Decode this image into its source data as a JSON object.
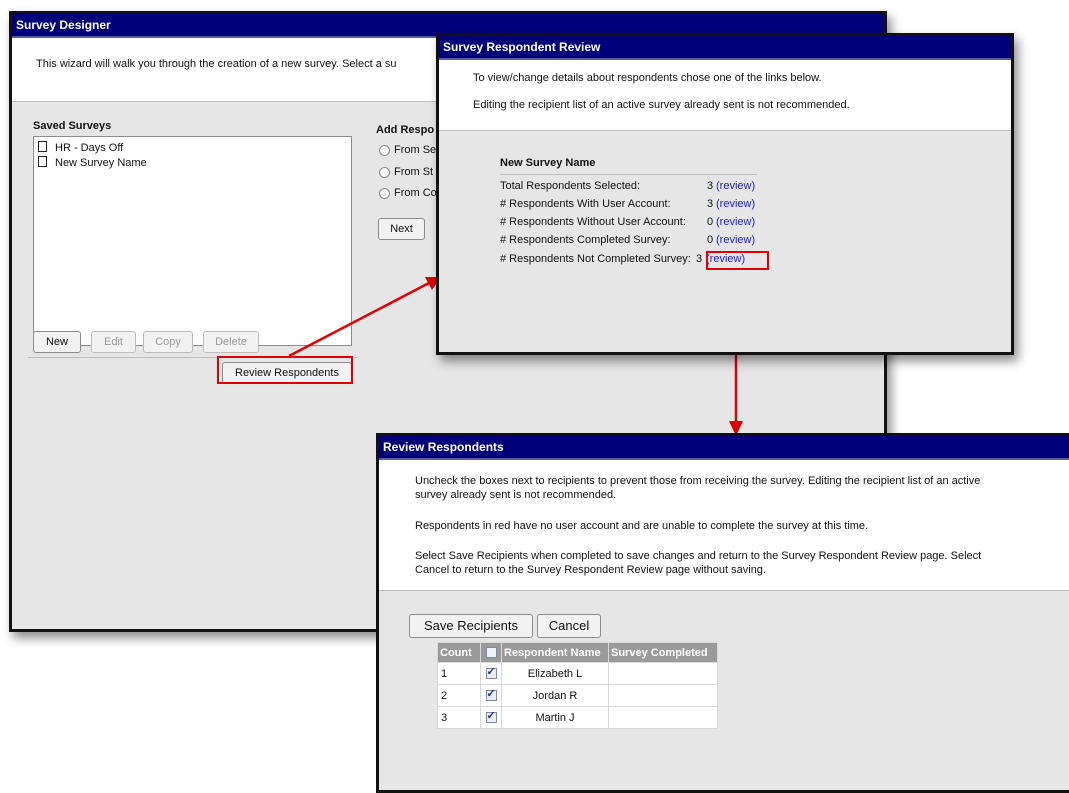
{
  "survey_designer": {
    "title": "Survey Designer",
    "intro": "This wizard will walk you through the creation of a new survey. Select a su",
    "saved_surveys_label": "Saved Surveys",
    "saved_surveys": [
      "HR - Days Off",
      "New Survey Name"
    ],
    "add_respondents_label": "Add Respo",
    "add_options": [
      "From Se",
      "From St",
      "From Co"
    ],
    "next_label": "Next",
    "new_label": "New",
    "edit_label": "Edit",
    "copy_label": "Copy",
    "delete_label": "Delete",
    "review_label": "Review Respondents"
  },
  "respondent_review": {
    "title": "Survey Respondent Review",
    "intro1": "To view/change details about respondents chose one of the links below.",
    "intro2": "Editing the recipient list of an active survey already sent is not recommended.",
    "survey_name": "New Survey Name",
    "rows": [
      {
        "label": "Total Respondents Selected:",
        "count": "3",
        "link": "(review)"
      },
      {
        "label": "# Respondents With User Account:",
        "count": "3",
        "link": "(review)"
      },
      {
        "label": "# Respondents Without User Account:",
        "count": "0",
        "link": "(review)"
      },
      {
        "label": "# Respondents Completed Survey:",
        "count": "0",
        "link": "(review)"
      },
      {
        "label": "# Respondents Not Completed Survey:",
        "count": "3",
        "link": "(review)"
      }
    ]
  },
  "review_respondents": {
    "title": "Review Respondents",
    "para1_line1": "Uncheck the boxes next to recipients to prevent those from receiving the survey. Editing the recipient list of an active",
    "para1_line2": "survey already sent is not recommended.",
    "para2": "Respondents in red have no user account and are unable to complete the survey at this time.",
    "para3_line1": "Select Save Recipients when completed to save changes and return to the Survey Respondent Review page. Select",
    "para3_line2": "Cancel to return to the Survey Respondent Review page without saving.",
    "save_label": "Save Recipients",
    "cancel_label": "Cancel",
    "columns": [
      "Count",
      "",
      "Respondent Name",
      "Survey Completed"
    ],
    "respondents": [
      {
        "count": "1",
        "checked": true,
        "name": "Elizabeth L",
        "completed": ""
      },
      {
        "count": "2",
        "checked": true,
        "name": "Jordan R",
        "completed": ""
      },
      {
        "count": "3",
        "checked": true,
        "name": "Martin J",
        "completed": ""
      }
    ]
  },
  "colors": {
    "titlebar": "#00007a",
    "highlight": "#e00000",
    "link": "#1a1adb",
    "panel": "#e6e6e6"
  }
}
